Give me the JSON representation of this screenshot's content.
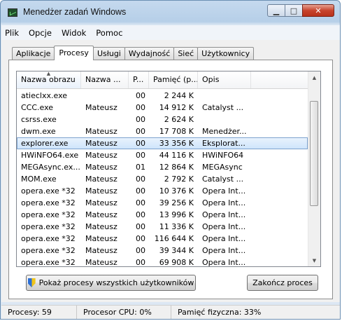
{
  "window": {
    "title": "Menedżer zadań Windows"
  },
  "menu": [
    "Plik",
    "Opcje",
    "Widok",
    "Pomoc"
  ],
  "tabs": [
    "Aplikacje",
    "Procesy",
    "Usługi",
    "Wydajność",
    "Sieć",
    "Użytkownicy"
  ],
  "active_tab": "Procesy",
  "columns": [
    "Nazwa obrazu",
    "Nazwa ...",
    "P...",
    "Pamięć (p...",
    "Opis"
  ],
  "rows": [
    {
      "name": "atieclxx.exe",
      "user": "",
      "cpu": "00",
      "mem": "2 244 K",
      "desc": ""
    },
    {
      "name": "CCC.exe",
      "user": "Mateusz",
      "cpu": "00",
      "mem": "14 912 K",
      "desc": "Catalyst ..."
    },
    {
      "name": "csrss.exe",
      "user": "",
      "cpu": "00",
      "mem": "2 624 K",
      "desc": ""
    },
    {
      "name": "dwm.exe",
      "user": "Mateusz",
      "cpu": "00",
      "mem": "17 708 K",
      "desc": "Menedżer..."
    },
    {
      "name": "explorer.exe",
      "user": "Mateusz",
      "cpu": "00",
      "mem": "33 356 K",
      "desc": "Eksplorat..."
    },
    {
      "name": "HWiNFO64.exe",
      "user": "Mateusz",
      "cpu": "00",
      "mem": "44 116 K",
      "desc": "HWiNFO64"
    },
    {
      "name": "MEGAsync.ex...",
      "user": "Mateusz",
      "cpu": "01",
      "mem": "12 864 K",
      "desc": "MEGAsync"
    },
    {
      "name": "MOM.exe",
      "user": "Mateusz",
      "cpu": "00",
      "mem": "2 792 K",
      "desc": "Catalyst ..."
    },
    {
      "name": "opera.exe *32",
      "user": "Mateusz",
      "cpu": "00",
      "mem": "10 376 K",
      "desc": "Opera Int..."
    },
    {
      "name": "opera.exe *32",
      "user": "Mateusz",
      "cpu": "00",
      "mem": "39 256 K",
      "desc": "Opera Int..."
    },
    {
      "name": "opera.exe *32",
      "user": "Mateusz",
      "cpu": "00",
      "mem": "13 996 K",
      "desc": "Opera Int..."
    },
    {
      "name": "opera.exe *32",
      "user": "Mateusz",
      "cpu": "00",
      "mem": "11 336 K",
      "desc": "Opera Int..."
    },
    {
      "name": "opera.exe *32",
      "user": "Mateusz",
      "cpu": "00",
      "mem": "116 644 K",
      "desc": "Opera Int..."
    },
    {
      "name": "opera.exe *32",
      "user": "Mateusz",
      "cpu": "00",
      "mem": "39 344 K",
      "desc": "Opera Int..."
    },
    {
      "name": "opera.exe *32",
      "user": "Mateusz",
      "cpu": "00",
      "mem": "69 908 K",
      "desc": "Opera Int..."
    }
  ],
  "selected_row": "explorer.exe",
  "buttons": {
    "show_all": "Pokaż procesy wszystkich użytkowników",
    "end_process": "Zakończ proces"
  },
  "status": {
    "processes": "Procesy: 59",
    "cpu": "Procesor CPU: 0%",
    "memory": "Pamięć fizyczna: 33%"
  },
  "icons": [
    "task-manager-icon",
    "uac-shield-icon",
    "sort-ascending-icon"
  ]
}
